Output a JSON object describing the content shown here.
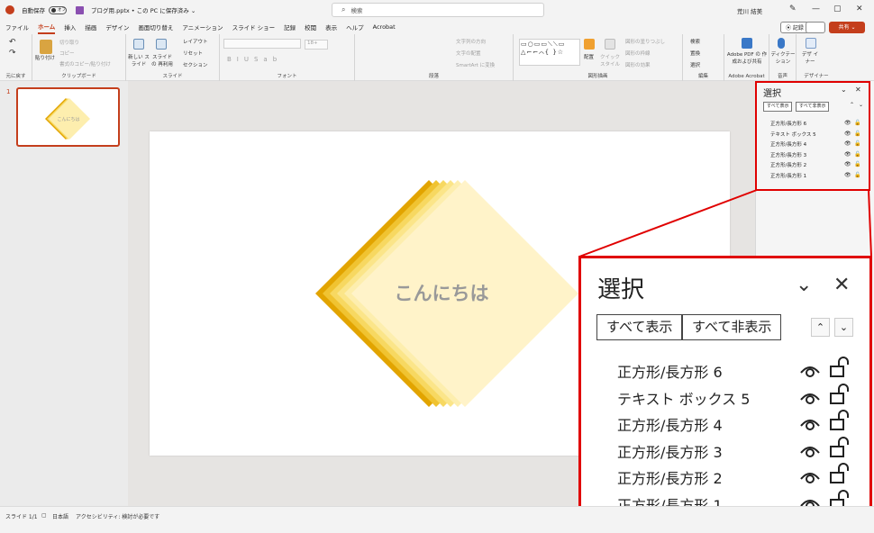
{
  "titlebar": {
    "autosave_label": "自動保存",
    "autosave_state": "オフ",
    "document": "ブログ用.pptx • この PC に保存済み ⌄",
    "search_placeholder": "検索",
    "user": "荒川 結美"
  },
  "menu": {
    "tabs": [
      "ファイル",
      "ホーム",
      "挿入",
      "描画",
      "デザイン",
      "画面切り替え",
      "アニメーション",
      "スライド ショー",
      "記録",
      "校閲",
      "表示",
      "ヘルプ",
      "Acrobat"
    ],
    "active": "ホーム",
    "record_label": "⦿ 記録",
    "share_label": "共有 ⌄"
  },
  "ribbon": {
    "undo_group": "元に戻す",
    "clipboard": {
      "name": "クリップボード",
      "paste": "貼り付け",
      "cut": "切り取り",
      "copy": "コピー",
      "format_painter": "書式のコピー/貼り付け"
    },
    "slides": {
      "name": "スライド",
      "new": "新しい スライド",
      "reuse": "スライドの 再利用",
      "layout": "レイアウト",
      "reset": "リセット",
      "section": "セクション"
    },
    "font": {
      "name": "フォント",
      "size": "18+"
    },
    "paragraph": {
      "name": "段落",
      "direction": "文字列の方向",
      "align": "文字の配置",
      "smartart": "SmartArt に変換"
    },
    "drawing": {
      "name": "図形描画",
      "arrange": "配置",
      "quick_styles": "クイック スタイル",
      "fill": "図形の塗りつぶし",
      "outline": "図形の枠線",
      "effects": "図形の効果"
    },
    "editing": {
      "name": "編集",
      "find": "検索",
      "replace": "置換",
      "select": "選択"
    },
    "acrobat": {
      "name": "Adobe Acrobat",
      "create": "Adobe PDF の 作成および共有"
    },
    "voice": {
      "name": "音声",
      "dictate": "ディクテー ション"
    },
    "designer": {
      "name": "デザイナー",
      "label": "デザ イナー"
    }
  },
  "thumb": {
    "number": "1",
    "text": "こんにちは"
  },
  "slide": {
    "text": "こんにちは",
    "colors": [
      "#e2a400",
      "#f0c331",
      "#f7d861",
      "#fbe589",
      "#fdeeae",
      "#fff3c9"
    ]
  },
  "selection_pane": {
    "title": "選択",
    "show_all": "すべて表示",
    "hide_all": "すべて非表示",
    "items": [
      "正方形/長方形 6",
      "テキスト ボックス 5",
      "正方形/長方形 4",
      "正方形/長方形 3",
      "正方形/長方形 2",
      "正方形/長方形 1"
    ]
  },
  "status": {
    "slide": "スライド 1/1",
    "language": "日本語",
    "accessibility": "アクセシビリティ: 検討が必要です"
  },
  "icons": {
    "highlight": "#e00000",
    "accent": "#c43e1c"
  }
}
